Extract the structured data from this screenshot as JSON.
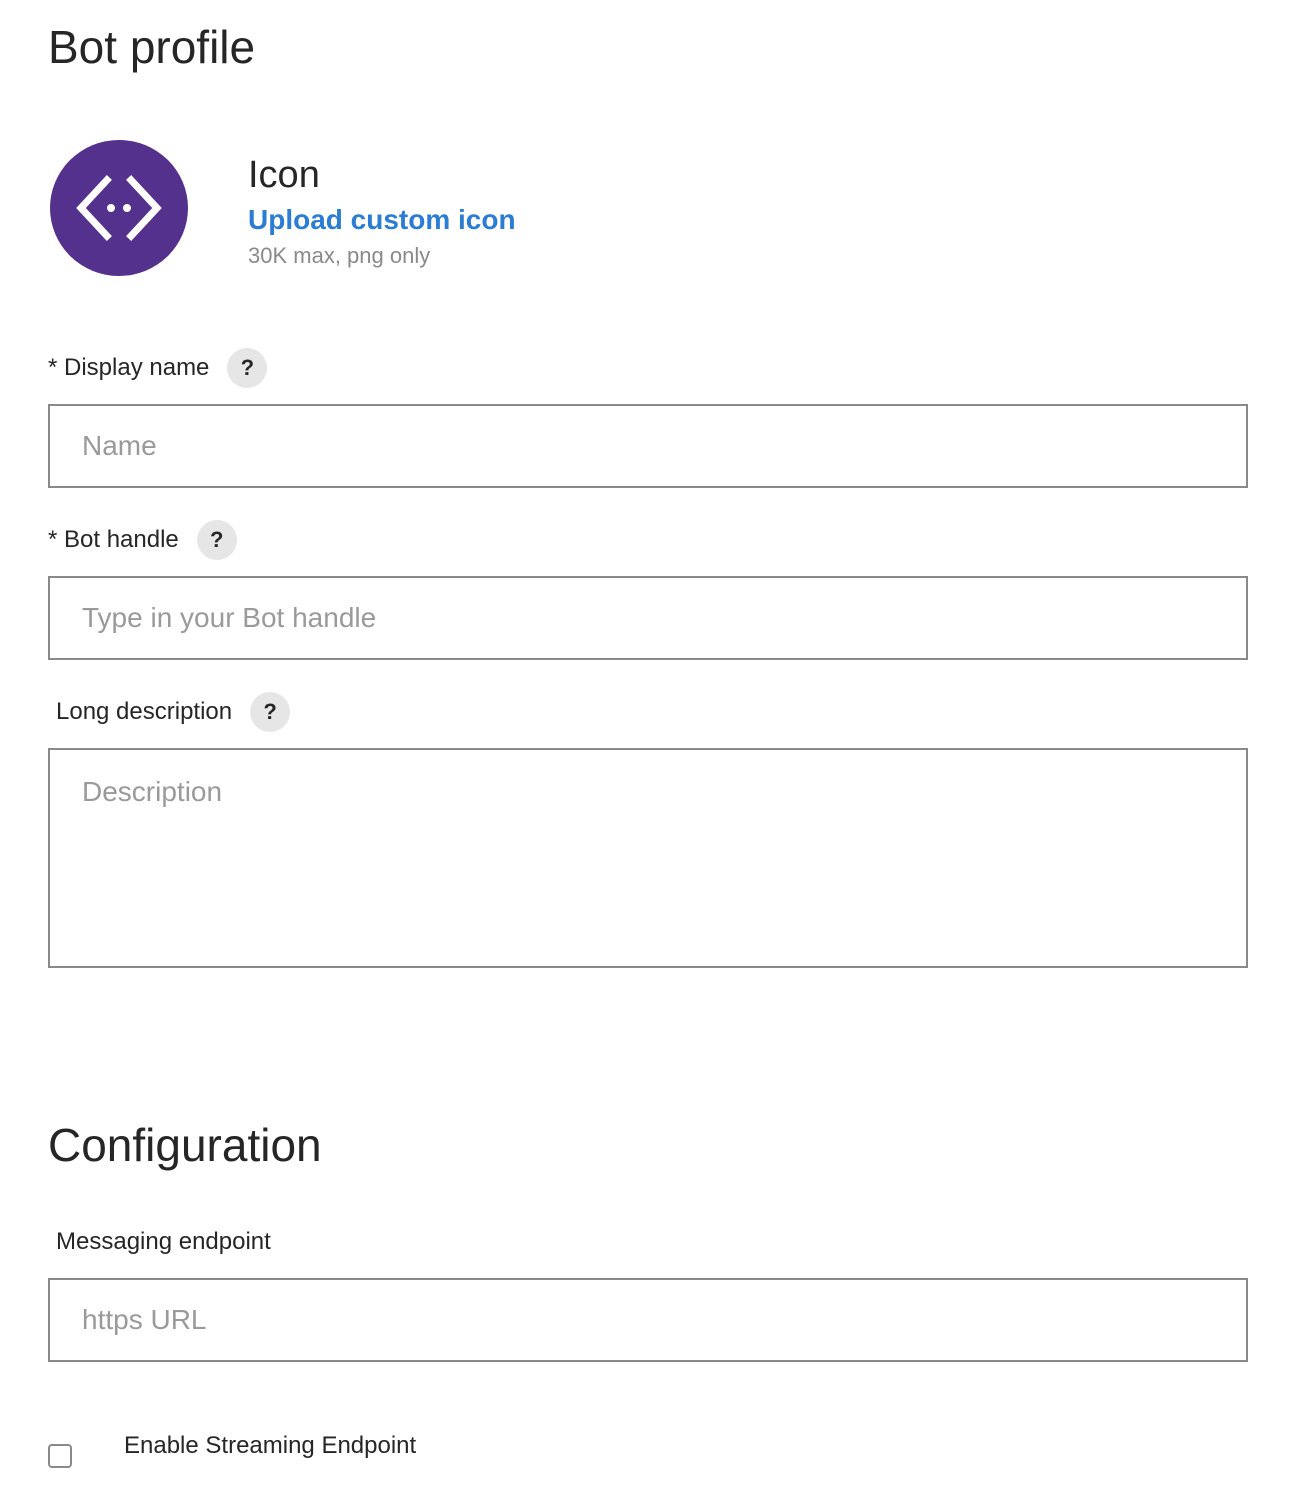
{
  "bot_profile": {
    "title": "Bot profile",
    "icon": {
      "heading": "Icon",
      "upload_link": "Upload custom icon",
      "hint": "30K max, png only",
      "avatar_icon": "code-brackets-icon",
      "avatar_color": "#54318c"
    },
    "display_name": {
      "label": "* Display name",
      "help": "?",
      "placeholder": "Name",
      "value": ""
    },
    "bot_handle": {
      "label": "* Bot handle",
      "help": "?",
      "placeholder": "Type in your Bot handle",
      "value": ""
    },
    "long_description": {
      "label": "Long description",
      "help": "?",
      "placeholder": "Description",
      "value": ""
    }
  },
  "configuration": {
    "title": "Configuration",
    "messaging_endpoint": {
      "label": "Messaging endpoint",
      "placeholder": "https URL",
      "value": ""
    },
    "streaming": {
      "label": "Enable Streaming Endpoint",
      "checked": false
    }
  },
  "colors": {
    "link": "#2b7cd3",
    "border": "#8a8a8a",
    "help_badge_bg": "#e6e6e6"
  }
}
